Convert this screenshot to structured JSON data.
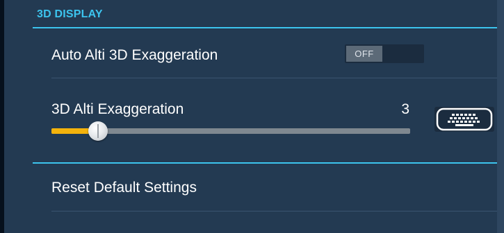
{
  "section": {
    "title": "3D DISPLAY"
  },
  "settings": {
    "auto_alti": {
      "label": "Auto Alti 3D Exaggeration",
      "toggle_value": "OFF"
    },
    "alti_exaggeration": {
      "label": "3D Alti Exaggeration",
      "value": "3",
      "slider_fraction": 0.13
    },
    "reset": {
      "label": "Reset Default Settings"
    }
  },
  "icons": {
    "keyboard": "keyboard-icon"
  },
  "colors": {
    "background": "#233a52",
    "accent": "#3cc4ee",
    "slider_fill": "#f4b30c"
  }
}
